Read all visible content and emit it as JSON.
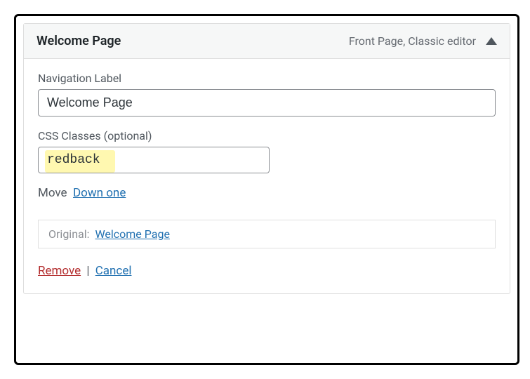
{
  "header": {
    "title": "Welcome Page",
    "meta": "Front Page, Classic editor"
  },
  "fields": {
    "nav_label": {
      "label": "Navigation Label",
      "value": "Welcome Page"
    },
    "css_classes": {
      "label": "CSS Classes (optional)",
      "value": "redback"
    }
  },
  "move": {
    "label": "Move",
    "down_one": "Down one"
  },
  "original": {
    "label": "Original:",
    "link_text": "Welcome Page"
  },
  "actions": {
    "remove": "Remove",
    "separator": "|",
    "cancel": "Cancel"
  }
}
